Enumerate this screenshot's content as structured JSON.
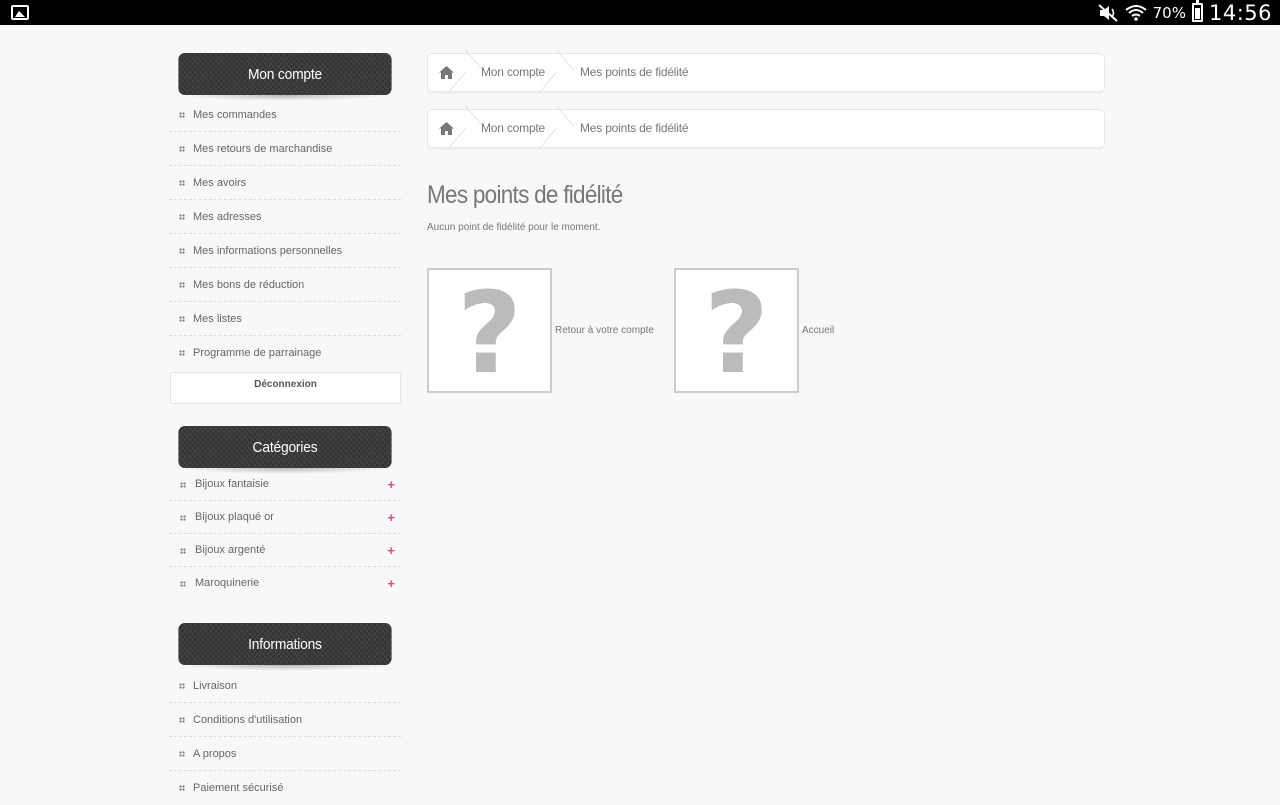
{
  "status_bar": {
    "battery_percent": "70%",
    "time": "14:56",
    "icons": [
      "gallery-icon",
      "mute-icon",
      "wifi-icon",
      "battery-icon"
    ]
  },
  "sidebar": {
    "account": {
      "title": "Mon compte",
      "items": [
        "Mes commandes",
        "Mes retours de marchandise",
        "Mes avoirs",
        "Mes adresses",
        "Mes informations personnelles",
        "Mes bons de réduction",
        "Mes listes",
        "Programme de parrainage"
      ],
      "logout_label": "Déconnexion"
    },
    "categories": {
      "title": "Catégories",
      "items": [
        "Bijoux fantaisie",
        "Bijoux plaqué or",
        "Bijoux argenté",
        "Maroquinerie"
      ],
      "expand_symbol": "+"
    },
    "informations": {
      "title": "Informations",
      "items": [
        "Livraison",
        "Conditions d'utilisation",
        "A propos",
        "Paiement sécurisé"
      ]
    }
  },
  "breadcrumb": {
    "items": [
      "Mon compte",
      "Mes points de fidélité"
    ]
  },
  "main": {
    "heading": "Mes points de fidélité",
    "notice": "Aucun point de fidélité pour le moment.",
    "links": [
      {
        "label": "Retour à votre compte",
        "image_glyph": "?"
      },
      {
        "label": "Accueil",
        "image_glyph": "?"
      }
    ]
  },
  "colors": {
    "accent_plus": "#e0478f",
    "block_title_bg": "#3a3a3a",
    "page_bg": "#f8f8f8"
  }
}
